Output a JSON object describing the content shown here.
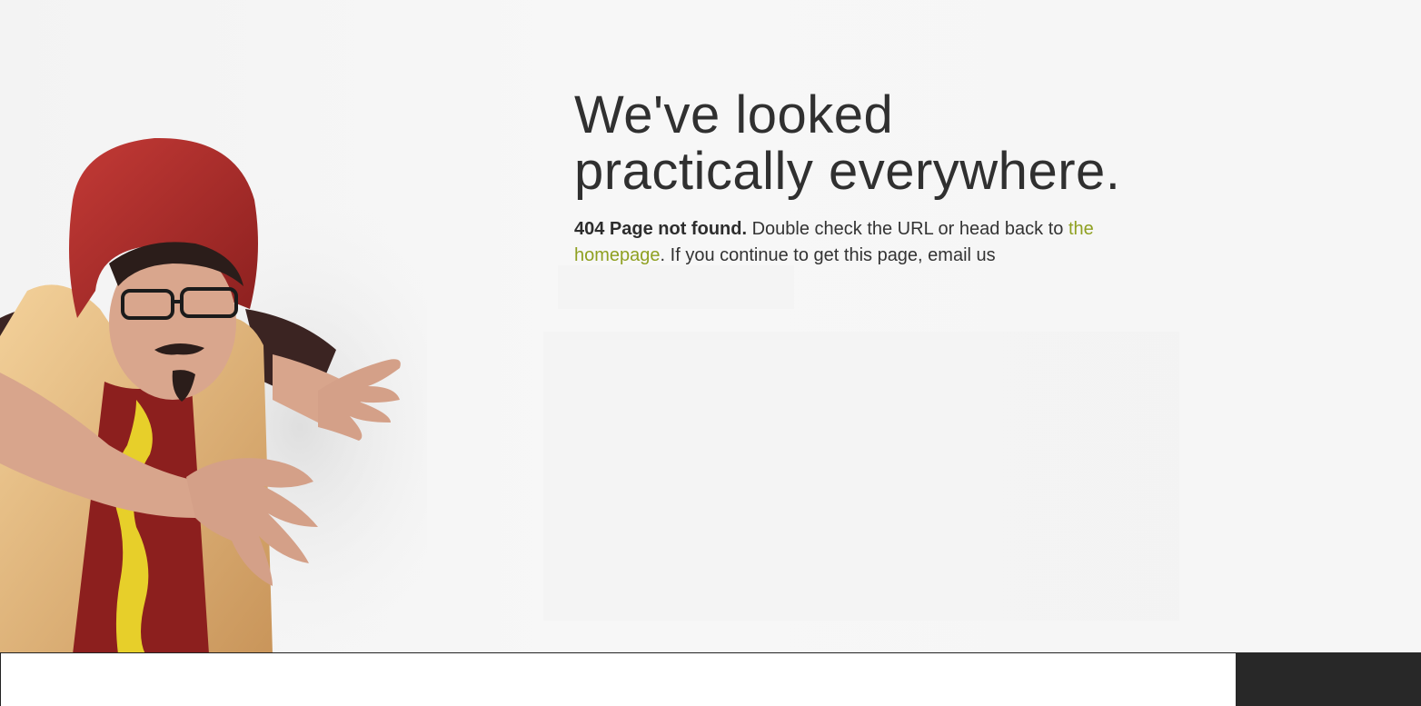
{
  "hero": {
    "illustration": "person-in-hotdog-costume-reaching",
    "colors": {
      "bun": "#e9c07a",
      "sausage": "#9a2522",
      "mustard": "#e7cf2a",
      "shirt": "#3b2422",
      "skin": "#d8a58c"
    }
  },
  "main": {
    "headline": "We've looked practically everywhere.",
    "message": {
      "status": "404 Page not found.",
      "text_before_link": " Double check the URL or head back to ",
      "link_label": "the homepage",
      "text_after_link": ". If you continue to get this page, email us"
    }
  },
  "footer": {
    "input_value": "",
    "button_label": ""
  },
  "colors": {
    "accent_link": "#8fa021",
    "text": "#303030",
    "background": "#f6f6f6",
    "footer_button": "#282828"
  }
}
